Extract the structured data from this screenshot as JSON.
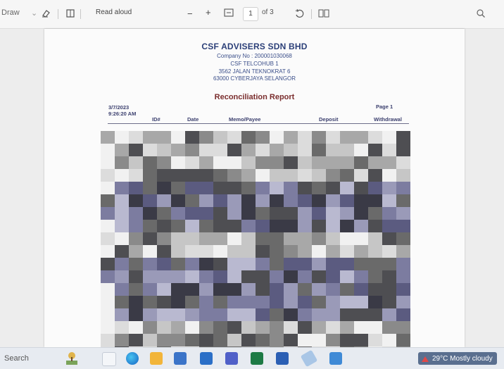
{
  "toolbar": {
    "draw_label": "Draw",
    "read_aloud_label": "Read aloud",
    "page_number": "1",
    "page_total": "of 3",
    "zoom_out": "−",
    "zoom_in": "+"
  },
  "document": {
    "company_name": "CSF ADVISERS SDN BHD",
    "company_no": "Company No : 200001030068",
    "address_line1": "CSF TELCOHUB 1",
    "address_line2": "3562 JALAN TEKNOKRAT 6",
    "address_line3": "63000 CYBERJAYA SELANGOR",
    "report_title": "Reconciliation Report",
    "date": "3/7/2023",
    "time": "9:26:20 AM",
    "page_label": "Page 1",
    "columns": [
      "ID#",
      "Date",
      "Memo/Payee",
      "Deposit",
      "Withdrawal"
    ]
  },
  "taskbar": {
    "search_label": "Search",
    "weather_text": "29°C  Mostly cloudy"
  },
  "colors": {
    "heading_blue": "#2b3f78",
    "title_red": "#7a2d2d",
    "taskbar_bg": "#e7ebf1"
  }
}
